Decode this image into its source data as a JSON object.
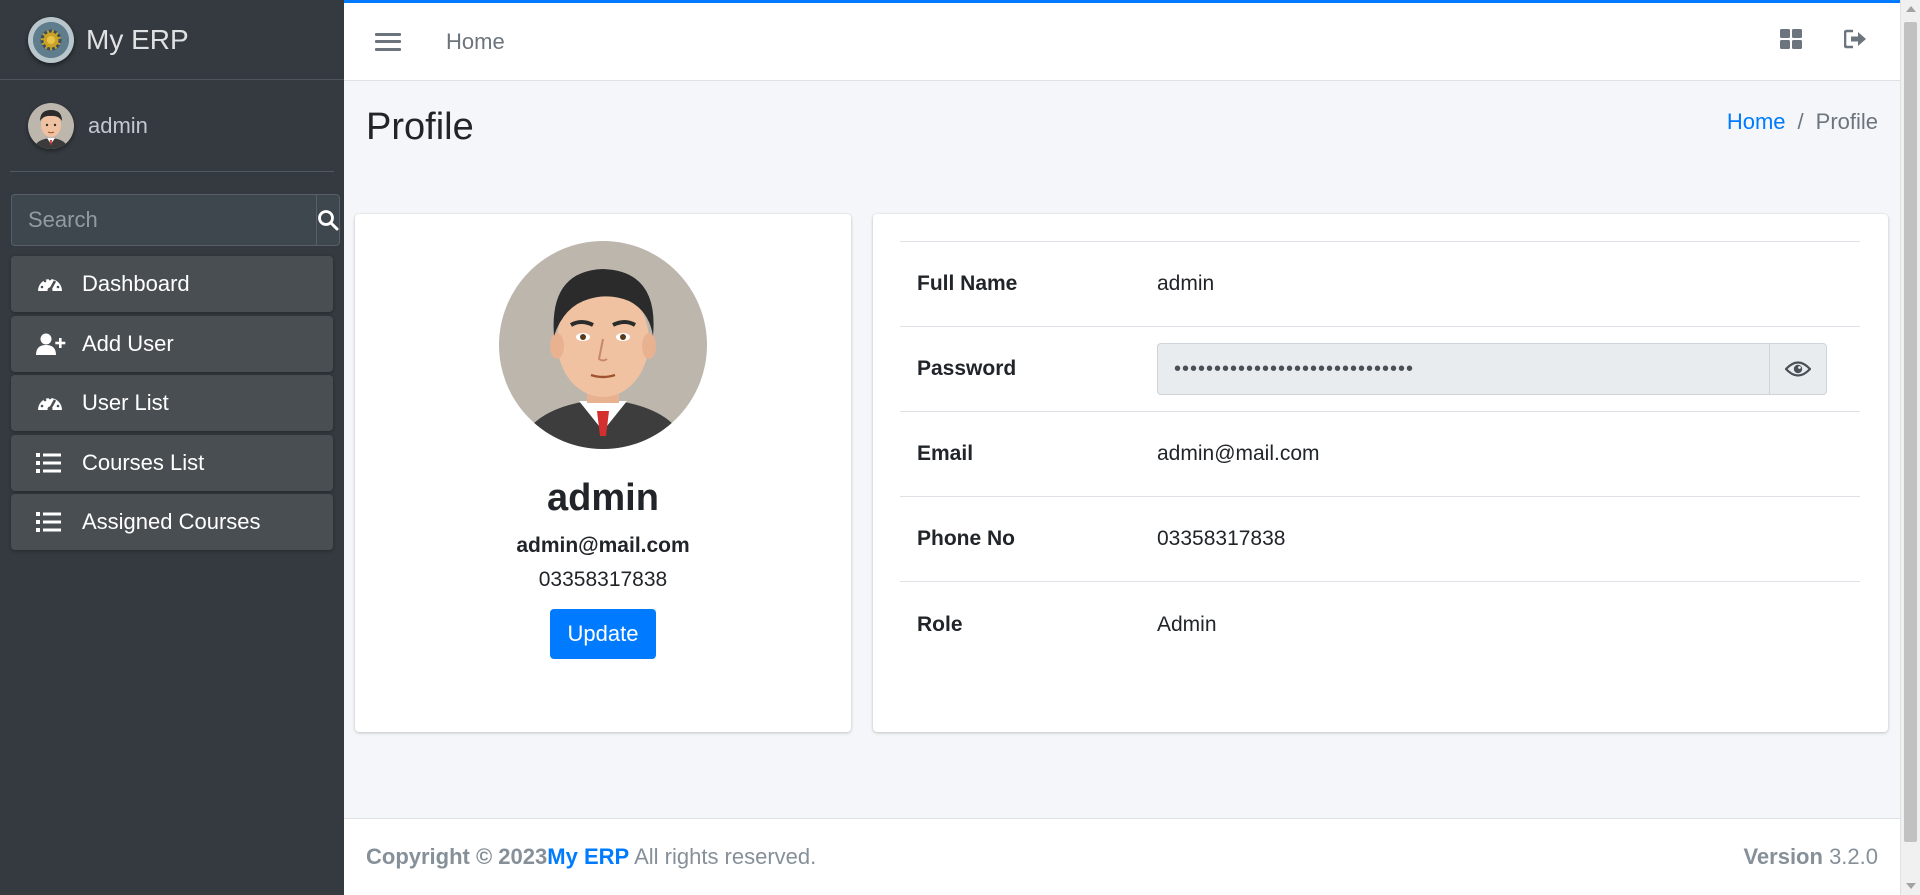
{
  "app": {
    "brand_name": "My ERP"
  },
  "user_panel": {
    "username": "admin"
  },
  "sidebar_search": {
    "placeholder": "Search"
  },
  "nav": [
    {
      "label": "Dashboard",
      "icon": "tachometer-icon"
    },
    {
      "label": "Add User",
      "icon": "user-plus-icon"
    },
    {
      "label": "User List",
      "icon": "tachometer-icon"
    },
    {
      "label": "Courses List",
      "icon": "list-icon"
    },
    {
      "label": "Assigned Courses",
      "icon": "list-icon"
    }
  ],
  "topbar": {
    "home_label": "Home"
  },
  "header": {
    "title": "Profile",
    "breadcrumb_home": "Home",
    "breadcrumb_sep": "/",
    "breadcrumb_active": "Profile"
  },
  "profile": {
    "name": "admin",
    "email": "admin@mail.com",
    "phone": "03358317838",
    "update_label": "Update"
  },
  "details": {
    "full_name_label": "Full Name",
    "full_name": "admin",
    "password_label": "Password",
    "password_mask": "••••••••••••••••••••••••••••••",
    "email_label": "Email",
    "email": "admin@mail.com",
    "phone_label": "Phone No",
    "phone": "03358317838",
    "role_label": "Role",
    "role": "Admin"
  },
  "footer": {
    "copyright_prefix": "Copyright © 2023",
    "brand_link": "My ERP",
    "copyright_suffix": " All rights reserved.",
    "version_label": "Version",
    "version": "3.2.0"
  },
  "colors": {
    "accent": "#007bff",
    "sidebar": "#343a40"
  }
}
